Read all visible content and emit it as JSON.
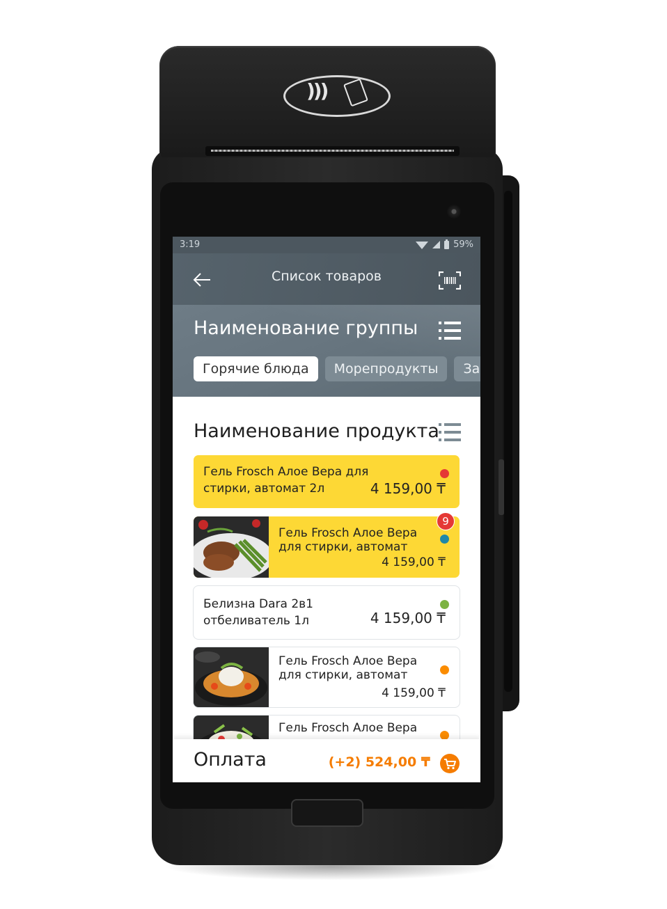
{
  "status_bar": {
    "time": "3:19",
    "battery": "59%"
  },
  "app_bar": {
    "title": "Список товаров",
    "back_icon": "arrow-left-icon",
    "scan_icon": "barcode-scan-icon"
  },
  "group": {
    "title": "Наименование группы",
    "chips": [
      {
        "label": "Горячие блюда",
        "active": true
      },
      {
        "label": "Морепродукты",
        "active": false
      },
      {
        "label": "Зак",
        "active": false
      }
    ]
  },
  "products": {
    "title": "Наименование продукта",
    "items": [
      {
        "name_line1": "Гель Frosch Алое Вера для",
        "name_line2": "стирки, автомат 2л",
        "price": "4 159,00 ₸",
        "dot_color": "#e53935",
        "has_image": false,
        "highlighted": true
      },
      {
        "name_line1": "Гель Frosch Алое Вера",
        "name_line2": "для стирки, автомат",
        "price": "4 159,00 ₸",
        "dot_color": "#1e88a8",
        "badge": "9",
        "has_image": true,
        "highlighted": true
      },
      {
        "name_line1": "Белизна Dara 2в1",
        "name_line2": "отбеливатель 1л",
        "price": "4 159,00 ₸",
        "dot_color": "#7cb342",
        "has_image": false,
        "highlighted": false
      },
      {
        "name_line1": "Гель Frosch Алое Вера",
        "name_line2": "для стирки, автомат",
        "price": "4 159,00 ₸",
        "dot_color": "#fb8c00",
        "has_image": true,
        "highlighted": false
      },
      {
        "name_line1": "Гель Frosch Алое Вера",
        "name_line2": "",
        "price": "",
        "dot_color": "#fb8c00",
        "has_image": true,
        "highlighted": false
      }
    ]
  },
  "footer": {
    "title": "Оплата",
    "total": "(+2) 524,00 ₸",
    "cart_icon": "cart-icon"
  },
  "colors": {
    "accent": "#f57c00",
    "highlight": "#fdd835",
    "header": "#4c575f"
  }
}
